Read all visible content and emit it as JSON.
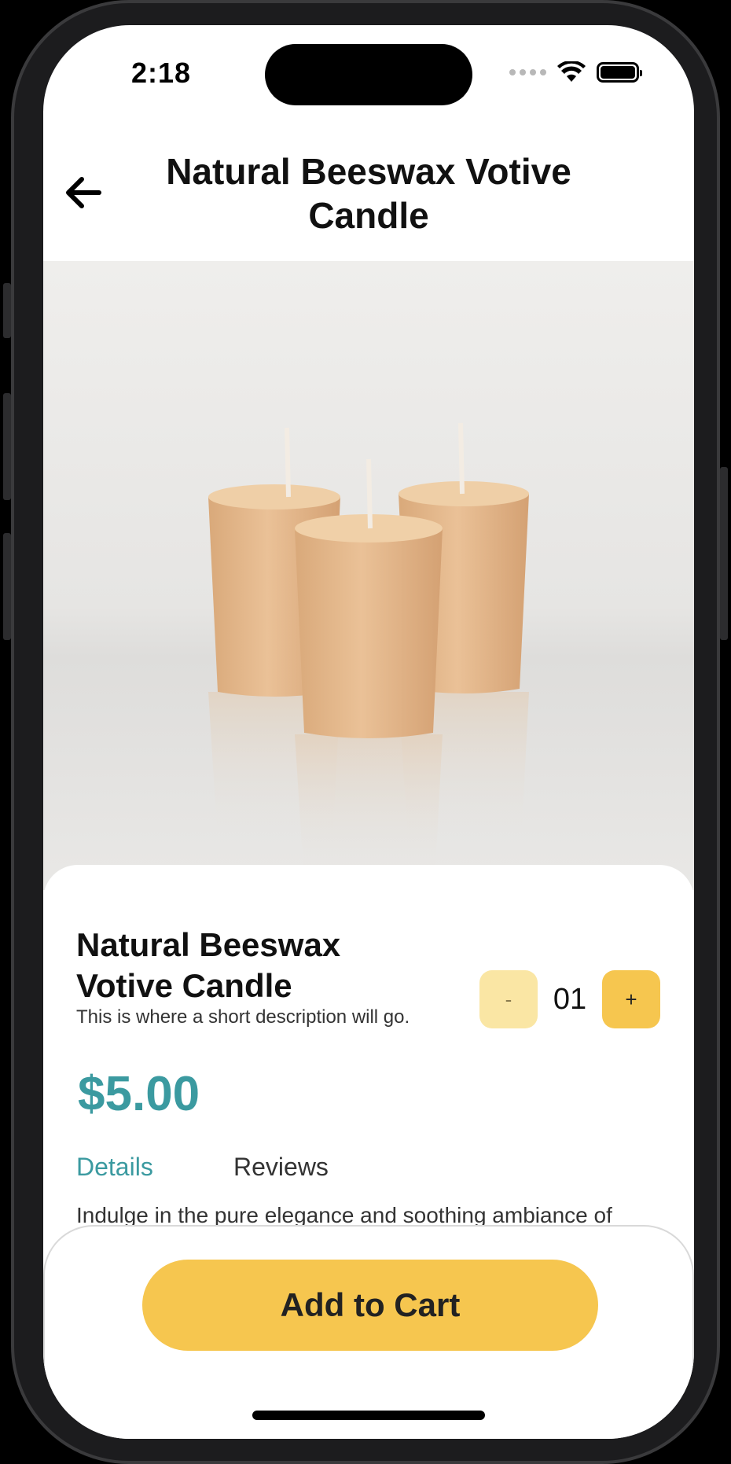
{
  "status_bar": {
    "time": "2:18"
  },
  "header": {
    "title": "Natural Beeswax Votive Candle",
    "back_icon": "arrow-left-icon"
  },
  "product": {
    "name": "Natural Beeswax Votive Candle",
    "short_description": "This is where a short description will go.",
    "price": "$5.00",
    "quantity": {
      "minus_label": "-",
      "value": "01",
      "plus_label": "+"
    },
    "tabs": {
      "details": "Details",
      "reviews": "Reviews"
    },
    "details_text": "Indulge in the pure elegance and soothing ambiance of our natural beeswax votive candle."
  },
  "actions": {
    "add_to_cart": "Add to Cart"
  },
  "colors": {
    "accent_teal": "#3b9aa0",
    "button_yellow": "#f6c64f",
    "button_yellow_light": "#fae6a4"
  }
}
